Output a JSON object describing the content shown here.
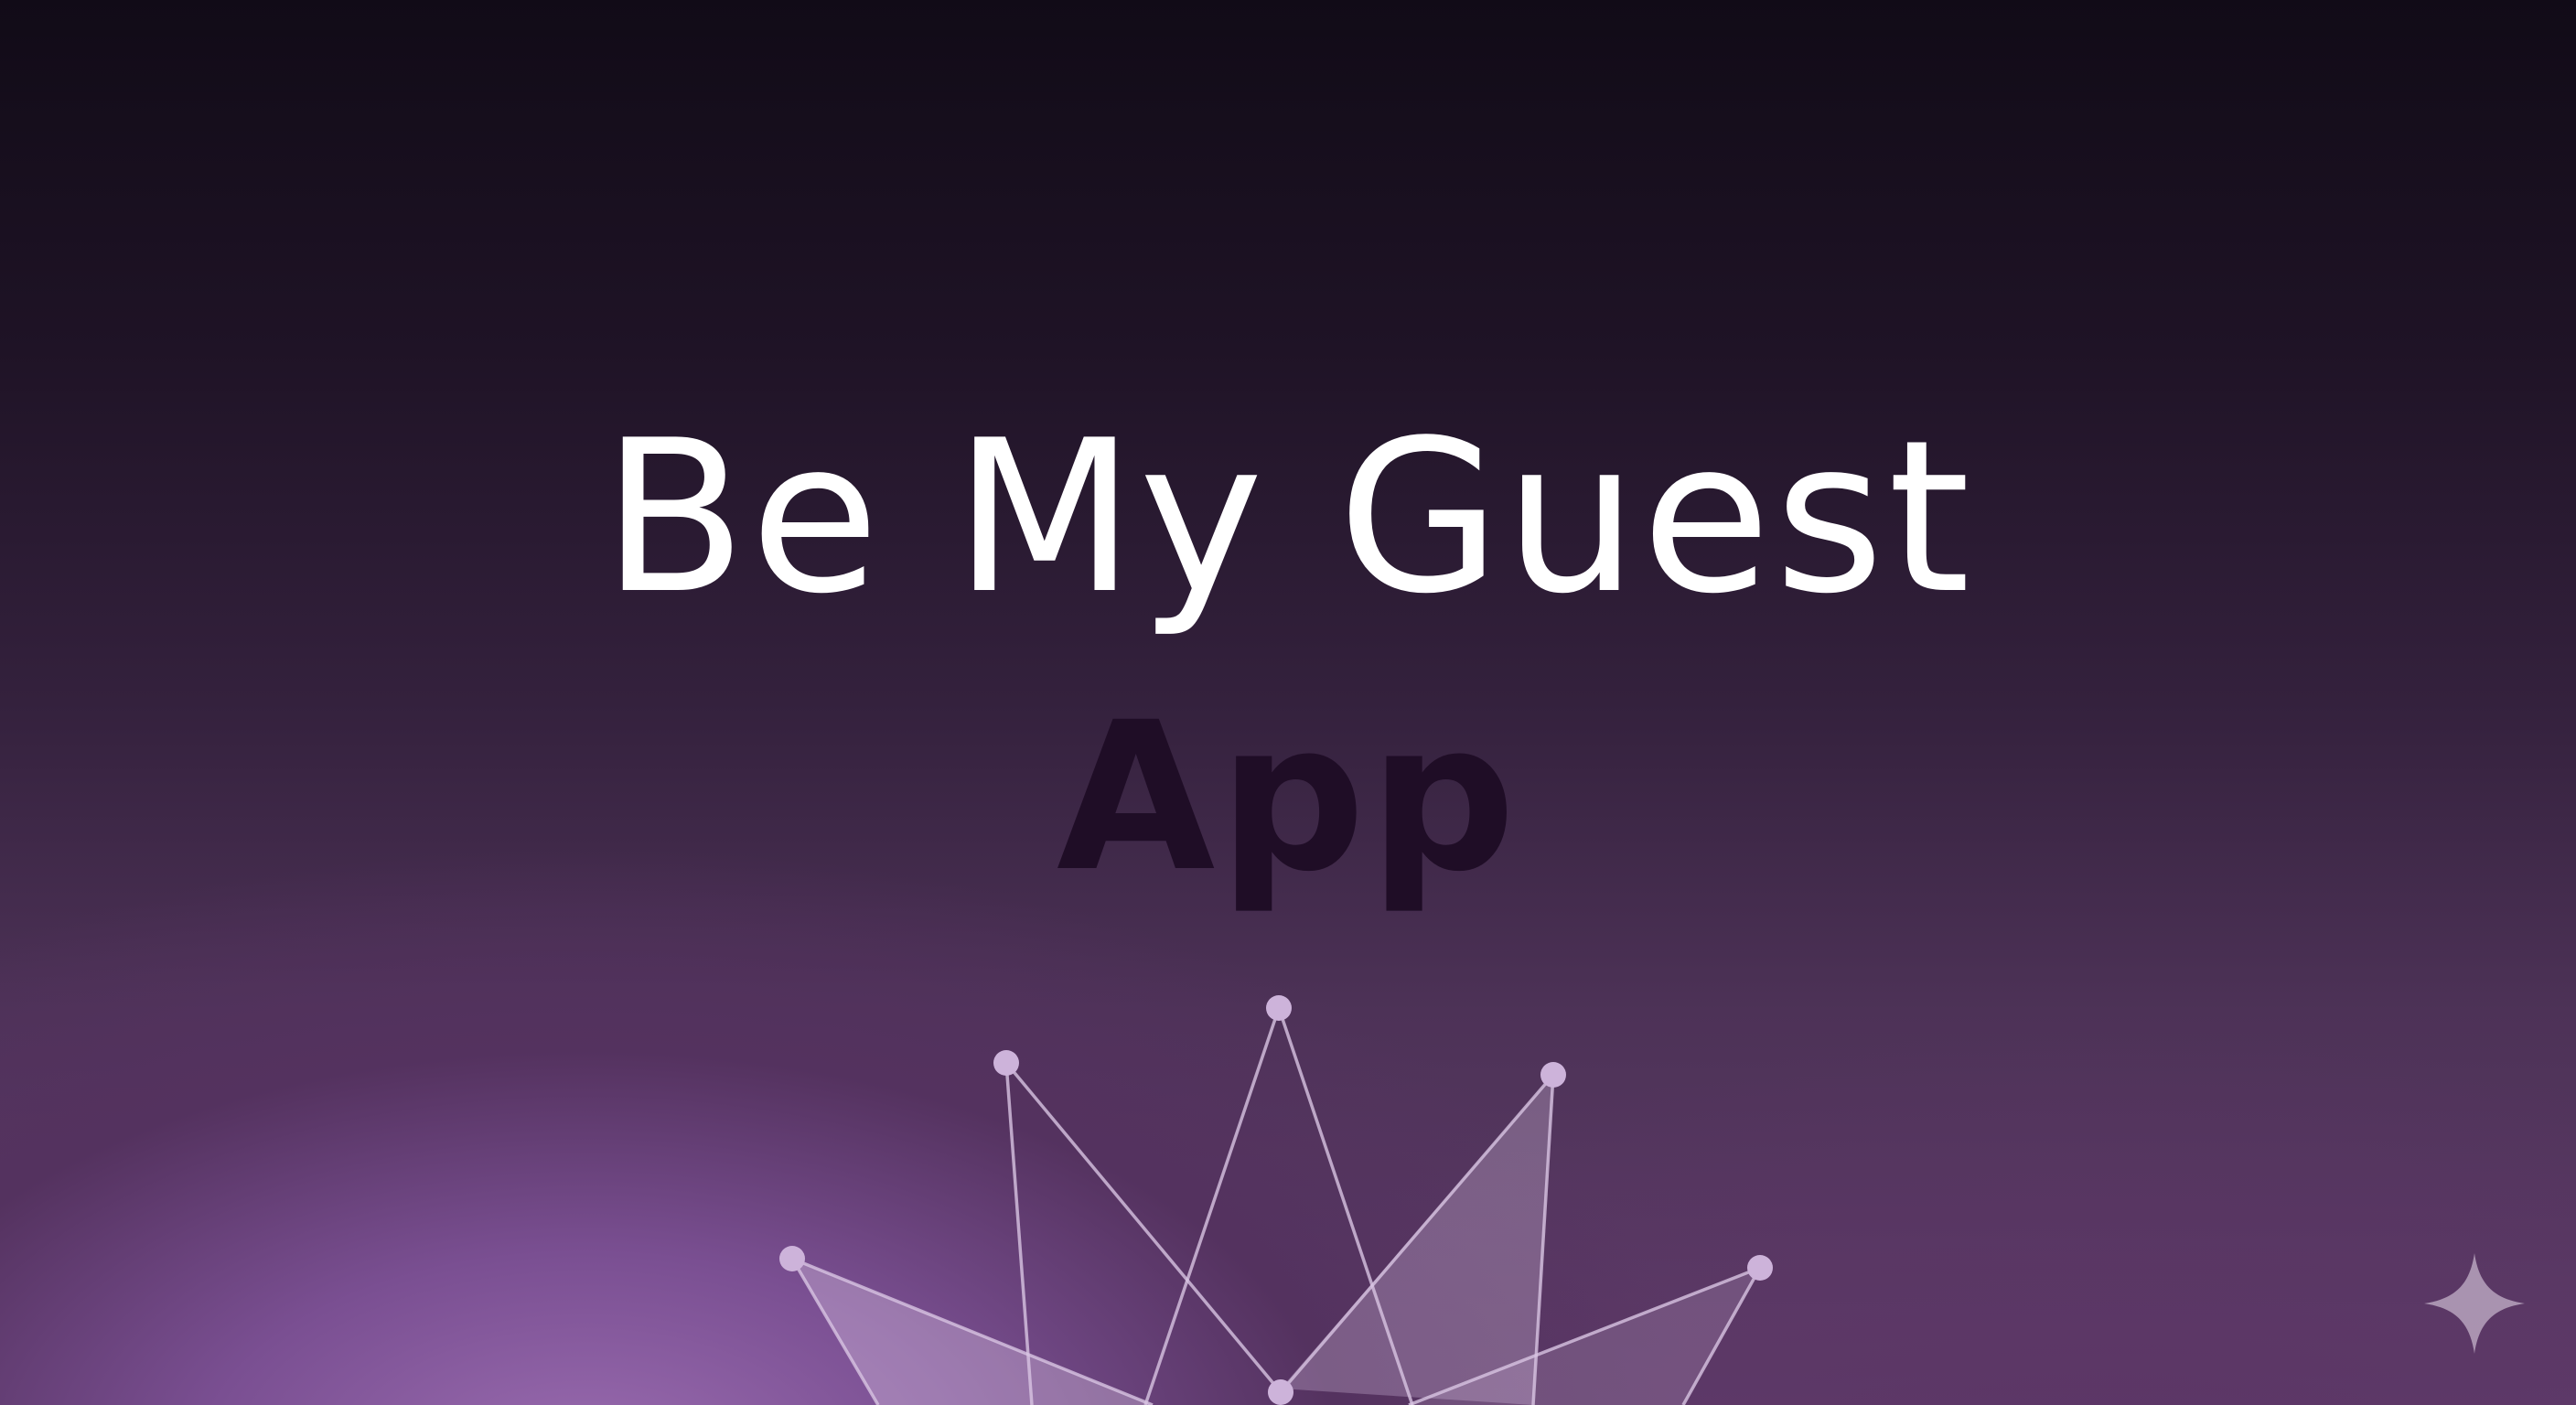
{
  "title": {
    "line1": "Be My Guest",
    "line2": "App"
  },
  "colors": {
    "title_primary": "#ffffff",
    "title_secondary": "#1f0d26",
    "background_top": "#110b17",
    "background_glow": "#9a6cb0",
    "graphic_stroke": "#d8c4e2",
    "graphic_fill": "#e2cdec"
  },
  "icons": {
    "crown_graphic": "crown-network-icon",
    "corner_mark": "sparkle-icon"
  }
}
